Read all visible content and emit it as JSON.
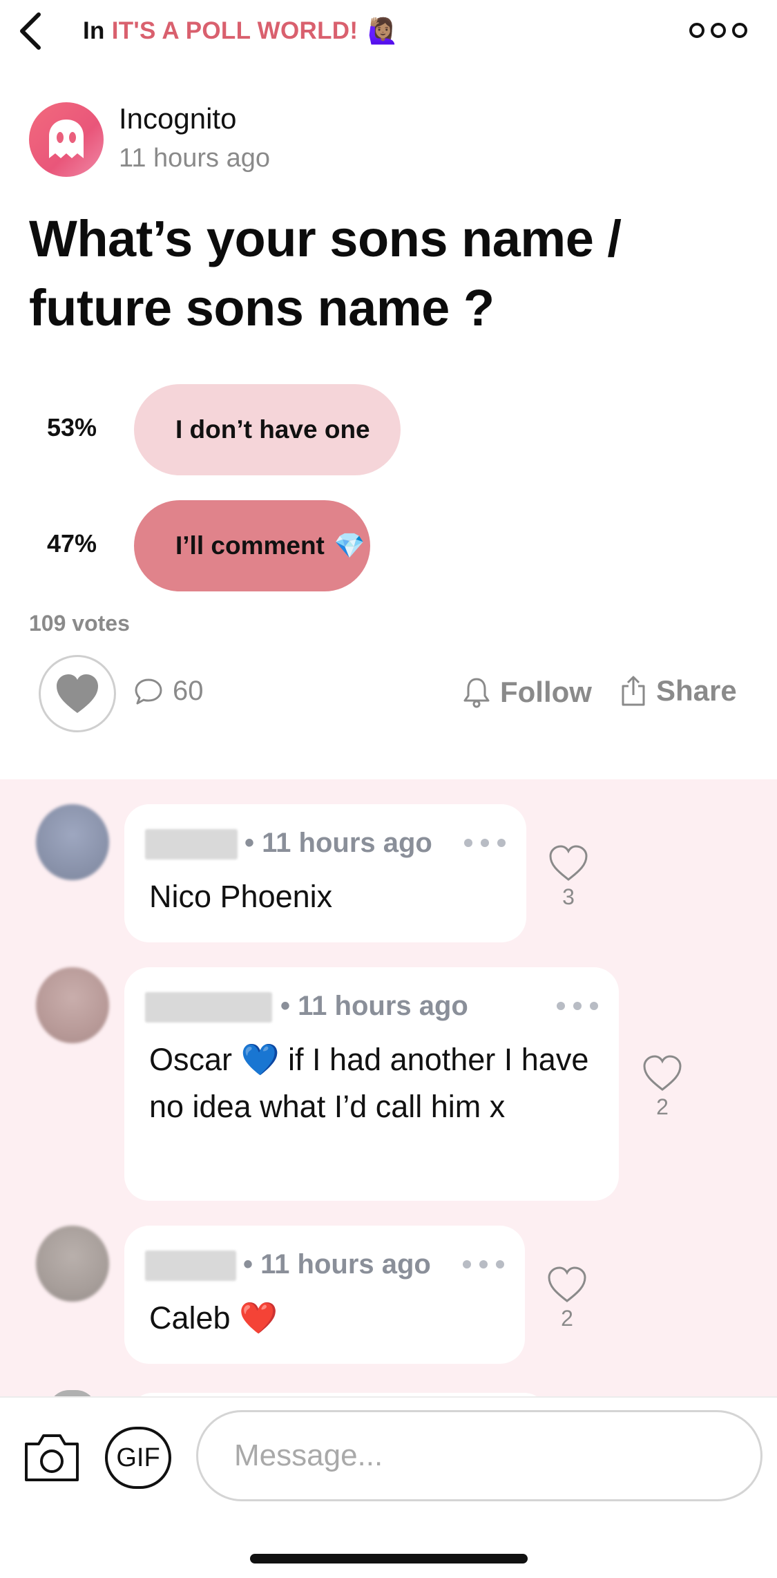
{
  "header": {
    "in_label": "In",
    "community_name": "IT'S A POLL WORLD!",
    "community_emoji": "🙋🏽‍♀️"
  },
  "post": {
    "author": "Incognito",
    "time": "11 hours ago",
    "title": "What’s your sons name / future sons name ?",
    "poll": [
      {
        "percent": "53%",
        "percent_value": 53,
        "label": "I don’t have one",
        "emoji": "",
        "color": "#f5d5d9"
      },
      {
        "percent": "47%",
        "percent_value": 47,
        "label": "I’ll comment",
        "emoji": "💎",
        "color": "#e0838b"
      }
    ],
    "votes": "109 votes",
    "comment_count": "60",
    "follow_label": "Follow",
    "share_label": "Share"
  },
  "comments": [
    {
      "time": "• 11 hours ago",
      "text": "Nico Phoenix",
      "likes": "3"
    },
    {
      "time": "• 11 hours ago",
      "text": "Oscar 💙 if I had another I have no idea what I’d call him x",
      "likes": "2"
    },
    {
      "time": "• 11 hours ago",
      "text": "Caleb ❤️",
      "likes": "2"
    }
  ],
  "composer": {
    "gif_label": "GIF",
    "placeholder": "Message..."
  },
  "colors": {
    "accent": "#d9606e",
    "comments_bg": "#fdeff2",
    "muted": "#8a8a8a"
  }
}
